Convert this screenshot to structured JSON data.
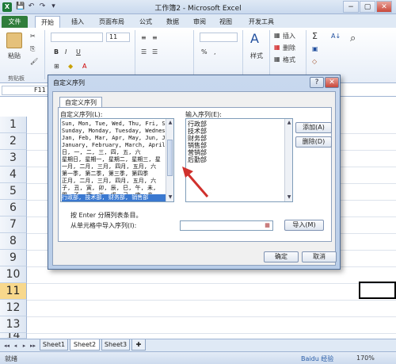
{
  "window": {
    "title": "工作簿2 - Microsoft Excel",
    "min": "−",
    "max": "▢",
    "close": "✕"
  },
  "qat": [
    "💾",
    "↶",
    "↷",
    "▾"
  ],
  "ribbon_tabs": [
    "文件",
    "开始",
    "插入",
    "页面布局",
    "公式",
    "数据",
    "审阅",
    "视图",
    "开发工具"
  ],
  "ribbon": {
    "paste_label": "粘贴",
    "clipboard_group": "剪贴板",
    "font_size_value": "11",
    "bold": "B",
    "italic": "I",
    "underline": "U",
    "styles_label": "样式",
    "insert_label": "插入",
    "delete_label": "删除",
    "format_label": "格式",
    "sigma": "Σ",
    "sort_label": "A↓"
  },
  "formula_bar": {
    "name_box": "F11"
  },
  "rows": [
    "1",
    "2",
    "3",
    "4",
    "5",
    "6",
    "7",
    "8",
    "9",
    "10",
    "11",
    "12",
    "13",
    "14"
  ],
  "selected_row": "11",
  "sheet_tabs": [
    "Sheet1",
    "Sheet2",
    "Sheet3"
  ],
  "active_sheet": "Sheet2",
  "nav_buttons": [
    "◂◂",
    "◂",
    "▸",
    "▸▸"
  ],
  "status": {
    "ready": "就绪",
    "zoom": "170%",
    "watermark": "Baidu 经验"
  },
  "dialog": {
    "title": "自定义序列",
    "help_btn": "?",
    "close_btn": "✕",
    "tab_label": "自定义序列",
    "custom_lists_label": "自定义序列(L):",
    "custom_lists": [
      "Sun, Mon, Tue, Wed, Thu, Fri, S",
      "Sunday, Monday, Tuesday, Wednes",
      "Jan, Feb, Mar, Apr, May, Jun, J",
      "January, February, March, April",
      "日, 一, 二, 三, 四, 五, 六",
      "星期日, 星期一, 星期二, 星期三, 星",
      "一月, 二月, 三月, 四月, 五月, 六",
      "第一季, 第二季, 第三季, 第四季",
      "正月, 二月, 三月, 四月, 五月, 六",
      "子, 丑, 寅, 卯, 辰, 巳, 午, 未,",
      "甲, 乙, 丙, 丁, 戊, 己, 庚, 辛",
      "行政部, 技术部, 财务部, 销售部"
    ],
    "selected_index": 11,
    "entries_label": "输入序列(E):",
    "entries": [
      "行政部",
      "技术部",
      "财务部",
      "销售部",
      "营销部",
      "后勤部"
    ],
    "add_btn": "添加(A)",
    "delete_btn": "删除(D)",
    "hint": "按 Enter 分隔列表条目。",
    "import_label": "从单元格中导入序列(I):",
    "import_btn": "导入(M)",
    "ok_btn": "确定",
    "cancel_btn": "取消"
  },
  "colors": {
    "accent_red": "#d0312d",
    "file_tab": "#2f7d3b",
    "selection": "#3a78d0"
  }
}
